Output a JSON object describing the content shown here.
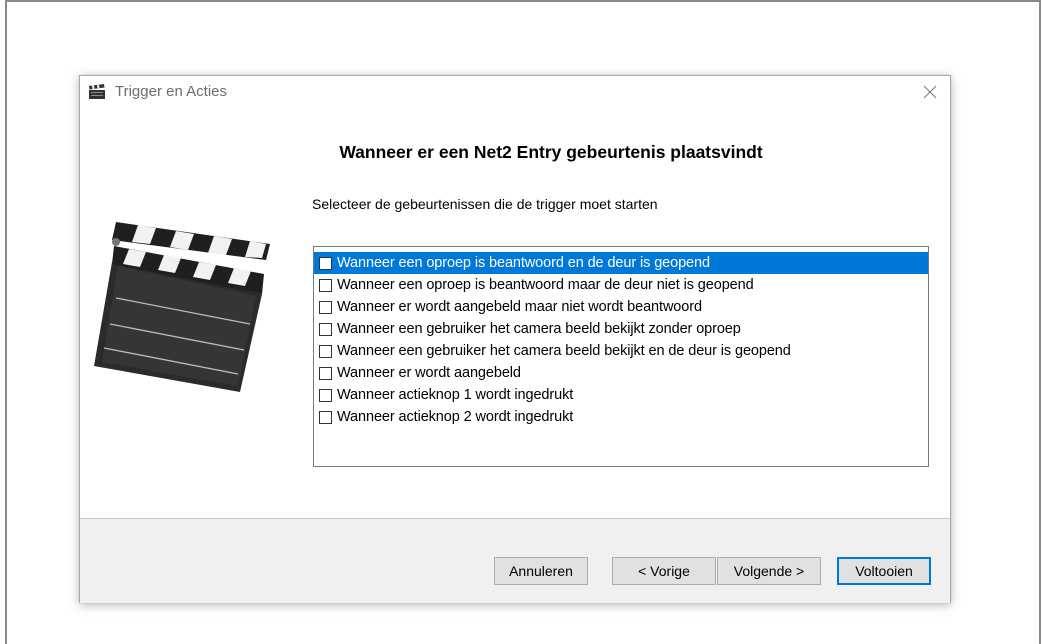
{
  "dialog": {
    "title": "Trigger en Acties",
    "heading": "Wanneer er een Net2 Entry gebeurtenis plaatsvindt",
    "instruction": "Selecteer de gebeurtenissen die de trigger moet starten",
    "events": [
      {
        "label": "Wanneer een oproep is beantwoord en de deur is geopend",
        "checked": false,
        "selected": true
      },
      {
        "label": "Wanneer een oproep is beantwoord maar de deur niet is geopend",
        "checked": false,
        "selected": false
      },
      {
        "label": "Wanneer er wordt aangebeld maar niet wordt beantwoord",
        "checked": false,
        "selected": false
      },
      {
        "label": "Wanneer een gebruiker het camera beeld bekijkt zonder oproep",
        "checked": false,
        "selected": false
      },
      {
        "label": "Wanneer een gebruiker het camera beeld bekijkt en de deur is geopend",
        "checked": false,
        "selected": false
      },
      {
        "label": "Wanneer er wordt aangebeld",
        "checked": false,
        "selected": false
      },
      {
        "label": "Wanneer actieknop 1 wordt ingedrukt",
        "checked": false,
        "selected": false
      },
      {
        "label": "Wanneer actieknop 2 wordt ingedrukt",
        "checked": false,
        "selected": false
      }
    ],
    "buttons": {
      "cancel": "Annuleren",
      "back": "< Vorige",
      "next": "Volgende >",
      "finish": "Voltooien"
    }
  },
  "colors": {
    "selection": "#0078d7",
    "footer_bg": "#f0f0f0",
    "button_bg": "#e1e1e1"
  },
  "icons": {
    "app": "clapperboard-icon",
    "close": "close-icon",
    "illustration": "clapperboard-illustration"
  }
}
